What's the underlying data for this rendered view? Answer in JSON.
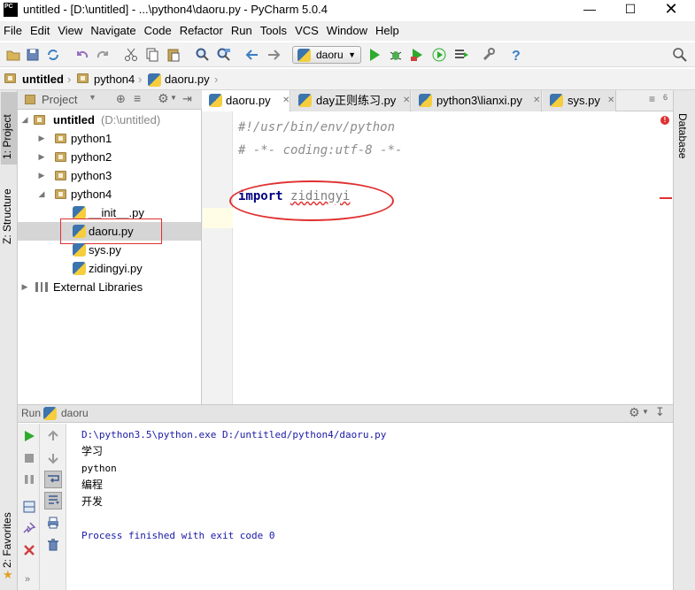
{
  "window": {
    "title": "untitled - [D:\\untitled] - ...\\python4\\daoru.py - PyCharm 5.0.4",
    "app_logo_text": "PC"
  },
  "menu": [
    "File",
    "Edit",
    "View",
    "Navigate",
    "Code",
    "Refactor",
    "Run",
    "Tools",
    "VCS",
    "Window",
    "Help"
  ],
  "toolbar": {
    "run_config": "daoru"
  },
  "breadcrumbs": [
    "untitled",
    "python4",
    "daoru.py"
  ],
  "left_tools": {
    "project_tab": "1: Project",
    "structure_tab": "Z: Structure",
    "favorites_tab": "2: Favorites"
  },
  "right_tools": {
    "database_tab": "Database"
  },
  "project_panel": {
    "header_label": "Project",
    "root": {
      "name": "untitled",
      "path": "(D:\\untitled)"
    },
    "folders": [
      "python1",
      "python2",
      "python3",
      "python4"
    ],
    "python4_files": [
      "__init__.py",
      "daoru.py",
      "sys.py",
      "zidingyi.py"
    ],
    "selected": "daoru.py",
    "external": "External Libraries"
  },
  "editor": {
    "tabs": [
      "daoru.py",
      "day正则练习.py",
      "python3\\lianxi.py",
      "sys.py"
    ],
    "active_tab": "daoru.py",
    "overflow_count": "6",
    "lines": [
      "#!/usr/bin/env/python",
      "# -*- coding:utf-8 -*-",
      "",
      "import zidingyi"
    ],
    "keyword": "import",
    "module": "zidingyi"
  },
  "run_panel": {
    "label": "Run",
    "config": "daoru",
    "output": [
      "D:\\python3.5\\python.exe D:/untitled/python4/daoru.py",
      "学习",
      "python",
      "编程",
      "开发",
      "",
      "Process finished with exit code 0"
    ]
  },
  "colors": {
    "annotation_red": "#e03030",
    "comment_gray": "#8c8c8c",
    "keyword": "#000080",
    "console_blue": "#1a1aa6",
    "run_green": "#2eaa2e"
  }
}
